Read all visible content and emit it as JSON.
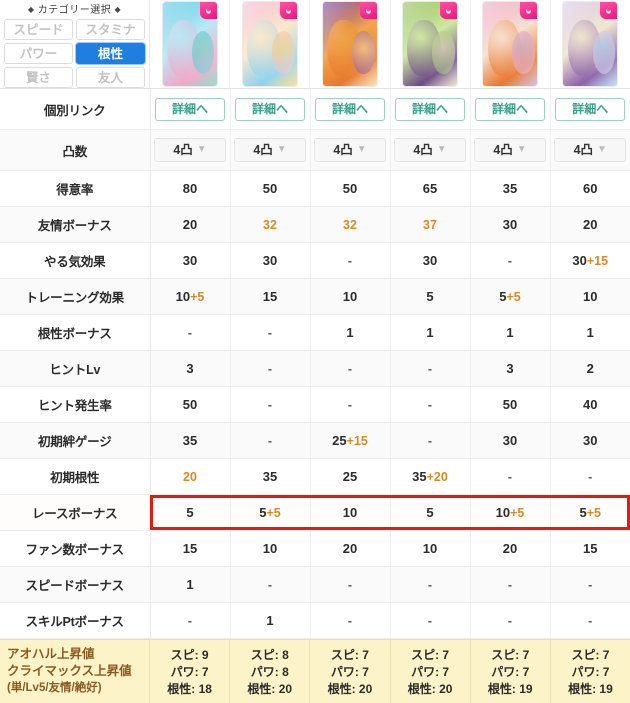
{
  "category": {
    "title": "カテゴリー選択",
    "marker": "◆",
    "buttons": [
      {
        "label": "スピード",
        "active": false
      },
      {
        "label": "スタミナ",
        "active": false
      },
      {
        "label": "パワー",
        "active": false
      },
      {
        "label": "根性",
        "active": true
      },
      {
        "label": "賢さ",
        "active": false
      },
      {
        "label": "友人",
        "active": false
      }
    ],
    "active_color": "#1f7fe0"
  },
  "cards": [
    {
      "name": "card-1",
      "badge_icon": "guts-flame-icon",
      "c1": "#5fc7e8",
      "c2": "#b7e9f5",
      "c3": "#f3a6c8",
      "c4": "#6ad0b4"
    },
    {
      "name": "card-2",
      "badge_icon": "guts-flame-icon",
      "c1": "#f6b8d8",
      "c2": "#fde9c9",
      "c3": "#8fd2f0",
      "c4": "#f7d36b"
    },
    {
      "name": "card-3",
      "badge_icon": "guts-flame-icon",
      "c1": "#7a3fa0",
      "c2": "#f0a64a",
      "c3": "#e8782c",
      "c4": "#f7d7a0"
    },
    {
      "name": "card-4",
      "badge_icon": "guts-flame-icon",
      "c1": "#8fc05a",
      "c2": "#cfe8a0",
      "c3": "#6b4a86",
      "c4": "#e8dcc0"
    },
    {
      "name": "card-5",
      "badge_icon": "guts-flame-icon",
      "c1": "#f0a6c8",
      "c2": "#f7e2cf",
      "c3": "#e8762a",
      "c4": "#bfa8d8"
    },
    {
      "name": "card-6",
      "badge_icon": "guts-flame-icon",
      "c1": "#d8c8e8",
      "c2": "#f0e6d0",
      "c3": "#8b5fa8",
      "c4": "#a9d6ef"
    }
  ],
  "accent": {
    "orange": "#d58a2a",
    "highlight_border": "#e01b10",
    "link": "#3f9c8c"
  },
  "rows": {
    "link": {
      "label": "個別リンク",
      "button_label": "詳細へ"
    },
    "limit": {
      "label": "凸数",
      "values": [
        "4凸",
        "4凸",
        "4凸",
        "4凸",
        "4凸",
        "4凸"
      ],
      "chevron": "chevron-down-icon"
    }
  },
  "table": [
    {
      "label": "得意率",
      "cells": [
        {
          "v": "80"
        },
        {
          "v": "50"
        },
        {
          "v": "50"
        },
        {
          "v": "65"
        },
        {
          "v": "35"
        },
        {
          "v": "60"
        }
      ]
    },
    {
      "label": "友情ボーナス",
      "cells": [
        {
          "v": "20"
        },
        {
          "v": "32",
          "o": true
        },
        {
          "v": "32",
          "o": true
        },
        {
          "v": "37",
          "o": true
        },
        {
          "v": "30"
        },
        {
          "v": "20"
        }
      ]
    },
    {
      "label": "やる気効果",
      "cells": [
        {
          "v": "30"
        },
        {
          "v": "30"
        },
        {
          "v": "-"
        },
        {
          "v": "30"
        },
        {
          "v": "-"
        },
        {
          "b": "30",
          "p": "+15"
        }
      ]
    },
    {
      "label": "トレーニング効果",
      "cells": [
        {
          "b": "10",
          "p": "+5"
        },
        {
          "v": "15"
        },
        {
          "v": "10"
        },
        {
          "v": "5"
        },
        {
          "b": "5",
          "p": "+5"
        },
        {
          "v": "10"
        }
      ]
    },
    {
      "label": "根性ボーナス",
      "cells": [
        {
          "v": "-"
        },
        {
          "v": "-"
        },
        {
          "v": "1"
        },
        {
          "v": "1"
        },
        {
          "v": "1"
        },
        {
          "v": "1"
        }
      ]
    },
    {
      "label": "ヒントLv",
      "cells": [
        {
          "v": "3"
        },
        {
          "v": "-"
        },
        {
          "v": "-"
        },
        {
          "v": "-"
        },
        {
          "v": "3"
        },
        {
          "v": "2"
        }
      ]
    },
    {
      "label": "ヒント発生率",
      "cells": [
        {
          "v": "50"
        },
        {
          "v": "-"
        },
        {
          "v": "-"
        },
        {
          "v": "-"
        },
        {
          "v": "50"
        },
        {
          "v": "40"
        }
      ]
    },
    {
      "label": "初期絆ゲージ",
      "cells": [
        {
          "v": "35"
        },
        {
          "v": "-"
        },
        {
          "b": "25",
          "p": "+15"
        },
        {
          "v": "-"
        },
        {
          "v": "30"
        },
        {
          "v": "30"
        }
      ]
    },
    {
      "label": "初期根性",
      "cells": [
        {
          "v": "20",
          "o": true
        },
        {
          "v": "35"
        },
        {
          "v": "25"
        },
        {
          "b": "35",
          "p": "+20"
        },
        {
          "v": "-"
        },
        {
          "v": "-"
        }
      ]
    },
    {
      "label": "レースボーナス",
      "highlight": true,
      "cells": [
        {
          "v": "5"
        },
        {
          "b": "5",
          "p": "+5"
        },
        {
          "v": "10"
        },
        {
          "v": "5"
        },
        {
          "b": "10",
          "p": "+5"
        },
        {
          "b": "5",
          "p": "+5"
        }
      ]
    },
    {
      "label": "ファン数ボーナス",
      "cells": [
        {
          "v": "15"
        },
        {
          "v": "10"
        },
        {
          "v": "20"
        },
        {
          "v": "10"
        },
        {
          "v": "20"
        },
        {
          "v": "15"
        }
      ]
    },
    {
      "label": "スピードボーナス",
      "cells": [
        {
          "v": "1"
        },
        {
          "v": "-"
        },
        {
          "v": "-"
        },
        {
          "v": "-"
        },
        {
          "v": "-"
        },
        {
          "v": "-"
        }
      ]
    },
    {
      "label": "スキルPtボーナス",
      "cells": [
        {
          "v": "-"
        },
        {
          "v": "1"
        },
        {
          "v": "-"
        },
        {
          "v": "-"
        },
        {
          "v": "-"
        },
        {
          "v": "-"
        }
      ]
    }
  ],
  "footer": {
    "line1": "アオハル上昇値",
    "line2": "クライマックス上昇値",
    "line3": "(単/Lv5/友情/絶好)",
    "columns": [
      {
        "speed": "スピ: 9",
        "power": "パワ: 7",
        "guts": "根性: 18"
      },
      {
        "speed": "スピ: 8",
        "power": "パワ: 8",
        "guts": "根性: 20"
      },
      {
        "speed": "スピ: 7",
        "power": "パワ: 7",
        "guts": "根性: 20"
      },
      {
        "speed": "スピ: 7",
        "power": "パワ: 7",
        "guts": "根性: 20"
      },
      {
        "speed": "スピ: 7",
        "power": "パワ: 7",
        "guts": "根性: 19"
      },
      {
        "speed": "スピ: 7",
        "power": "パワ: 7",
        "guts": "根性: 19"
      }
    ]
  }
}
